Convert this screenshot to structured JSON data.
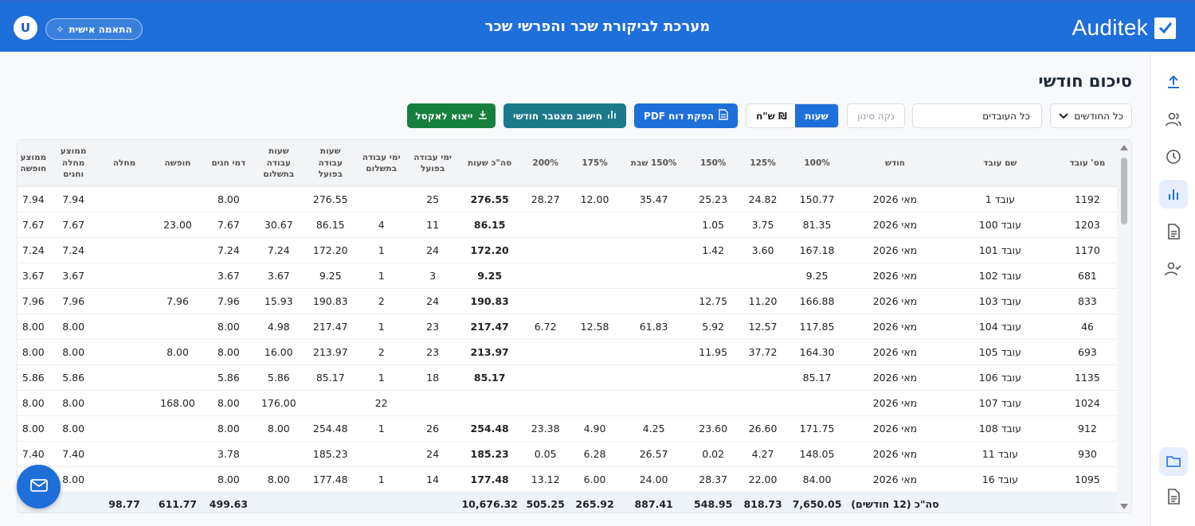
{
  "header": {
    "brand": "Auditek",
    "title": "מערכת לביקורת שכר והפרשי שכר",
    "avatar_letter": "U",
    "personal_label": "התאמה אישית"
  },
  "page": {
    "title": "סיכום חודשי"
  },
  "toolbar": {
    "months_select": "כל החודשים",
    "workers_select": "כל העובדים",
    "clear_filter": "נקה סינון",
    "toggle_hours": "שעות",
    "toggle_nis": "ש\"ח ₪",
    "pdf_button": "הפקת דוח PDF",
    "calc_button": "חישוב מצטבר חודשי",
    "excel_button": "ייצוא לאקסל"
  },
  "table": {
    "headers": [
      "מס' עובד",
      "שם עובד",
      "חודש",
      "100%",
      "125%",
      "150%",
      "150% שבת",
      "175%",
      "200%",
      "סה\"כ שעות",
      "ימי עבודה בפועל",
      "ימי עבודה בתשלום",
      "שעות עבודה בפועל",
      "שעות עבודה בתשלום",
      "דמי חגים",
      "חופשה",
      "מחלה",
      "ממוצע מחלה וחגים",
      "ממוצע חופשה"
    ],
    "rows": [
      [
        "1192",
        "עובד 1",
        "מאי 2026",
        "150.77",
        "24.82",
        "25.23",
        "35.47",
        "12.00",
        "28.27",
        "276.55",
        "25",
        "",
        "276.55",
        "",
        "8.00",
        "",
        "",
        "7.94",
        "7.94"
      ],
      [
        "1203",
        "עובד 100",
        "מאי 2026",
        "81.35",
        "3.75",
        "1.05",
        "",
        "",
        "",
        "86.15",
        "11",
        "4",
        "86.15",
        "30.67",
        "7.67",
        "23.00",
        "",
        "7.67",
        "7.67"
      ],
      [
        "1170",
        "עובד 101",
        "מאי 2026",
        "167.18",
        "3.60",
        "1.42",
        "",
        "",
        "",
        "172.20",
        "24",
        "1",
        "172.20",
        "7.24",
        "7.24",
        "",
        "",
        "7.24",
        "7.24"
      ],
      [
        "681",
        "עובד 102",
        "מאי 2026",
        "9.25",
        "",
        "",
        "",
        "",
        "",
        "9.25",
        "3",
        "1",
        "9.25",
        "3.67",
        "3.67",
        "",
        "",
        "3.67",
        "3.67"
      ],
      [
        "833",
        "עובד 103",
        "מאי 2026",
        "166.88",
        "11.20",
        "12.75",
        "",
        "",
        "",
        "190.83",
        "24",
        "2",
        "190.83",
        "15.93",
        "7.96",
        "7.96",
        "",
        "7.96",
        "7.96"
      ],
      [
        "46",
        "עובד 104",
        "מאי 2026",
        "117.85",
        "12.57",
        "5.92",
        "61.83",
        "12.58",
        "6.72",
        "217.47",
        "23",
        "1",
        "217.47",
        "4.98",
        "8.00",
        "",
        "",
        "8.00",
        "8.00"
      ],
      [
        "693",
        "עובד 105",
        "מאי 2026",
        "164.30",
        "37.72",
        "11.95",
        "",
        "",
        "",
        "213.97",
        "23",
        "2",
        "213.97",
        "16.00",
        "8.00",
        "8.00",
        "",
        "8.00",
        "8.00"
      ],
      [
        "1135",
        "עובד 106",
        "מאי 2026",
        "85.17",
        "",
        "",
        "",
        "",
        "",
        "85.17",
        "18",
        "1",
        "85.17",
        "5.86",
        "5.86",
        "",
        "",
        "5.86",
        "5.86"
      ],
      [
        "1024",
        "עובד 107",
        "מאי 2026",
        "",
        "",
        "",
        "",
        "",
        "",
        "",
        "",
        "22",
        "",
        "176.00",
        "8.00",
        "168.00",
        "",
        "8.00",
        "8.00"
      ],
      [
        "912",
        "עובד 108",
        "מאי 2026",
        "171.75",
        "26.60",
        "23.60",
        "4.25",
        "4.90",
        "23.38",
        "254.48",
        "26",
        "1",
        "254.48",
        "8.00",
        "8.00",
        "",
        "",
        "8.00",
        "8.00"
      ],
      [
        "930",
        "עובד 11",
        "מאי 2026",
        "148.05",
        "4.27",
        "0.02",
        "26.57",
        "6.28",
        "0.05",
        "185.23",
        "24",
        "",
        "185.23",
        "",
        "3.78",
        "",
        "",
        "7.40",
        "7.40"
      ],
      [
        "1095",
        "עובד 16",
        "מאי 2026",
        "84.00",
        "22.00",
        "28.37",
        "24.00",
        "6.00",
        "13.12",
        "177.48",
        "14",
        "1",
        "177.48",
        "8.00",
        "8.00",
        "",
        "",
        "8.00",
        "8.00"
      ]
    ],
    "total": [
      "",
      "",
      "סה\"כ (12 חודשים)",
      "7,650.05",
      "818.73",
      "548.95",
      "887.41",
      "265.92",
      "505.25",
      "10,676.32",
      "",
      "",
      "",
      "",
      "499.63",
      "611.77",
      "98.77",
      "",
      ""
    ]
  },
  "colors": {
    "primary": "#1e6fd9",
    "teal": "#1d7a8c",
    "green": "#15803d"
  },
  "icons": [
    "upload-icon",
    "users-icon",
    "clock-icon",
    "chart-icon",
    "document-icon",
    "user-check-icon",
    "folder-icon",
    "file-icon",
    "mail-icon"
  ]
}
